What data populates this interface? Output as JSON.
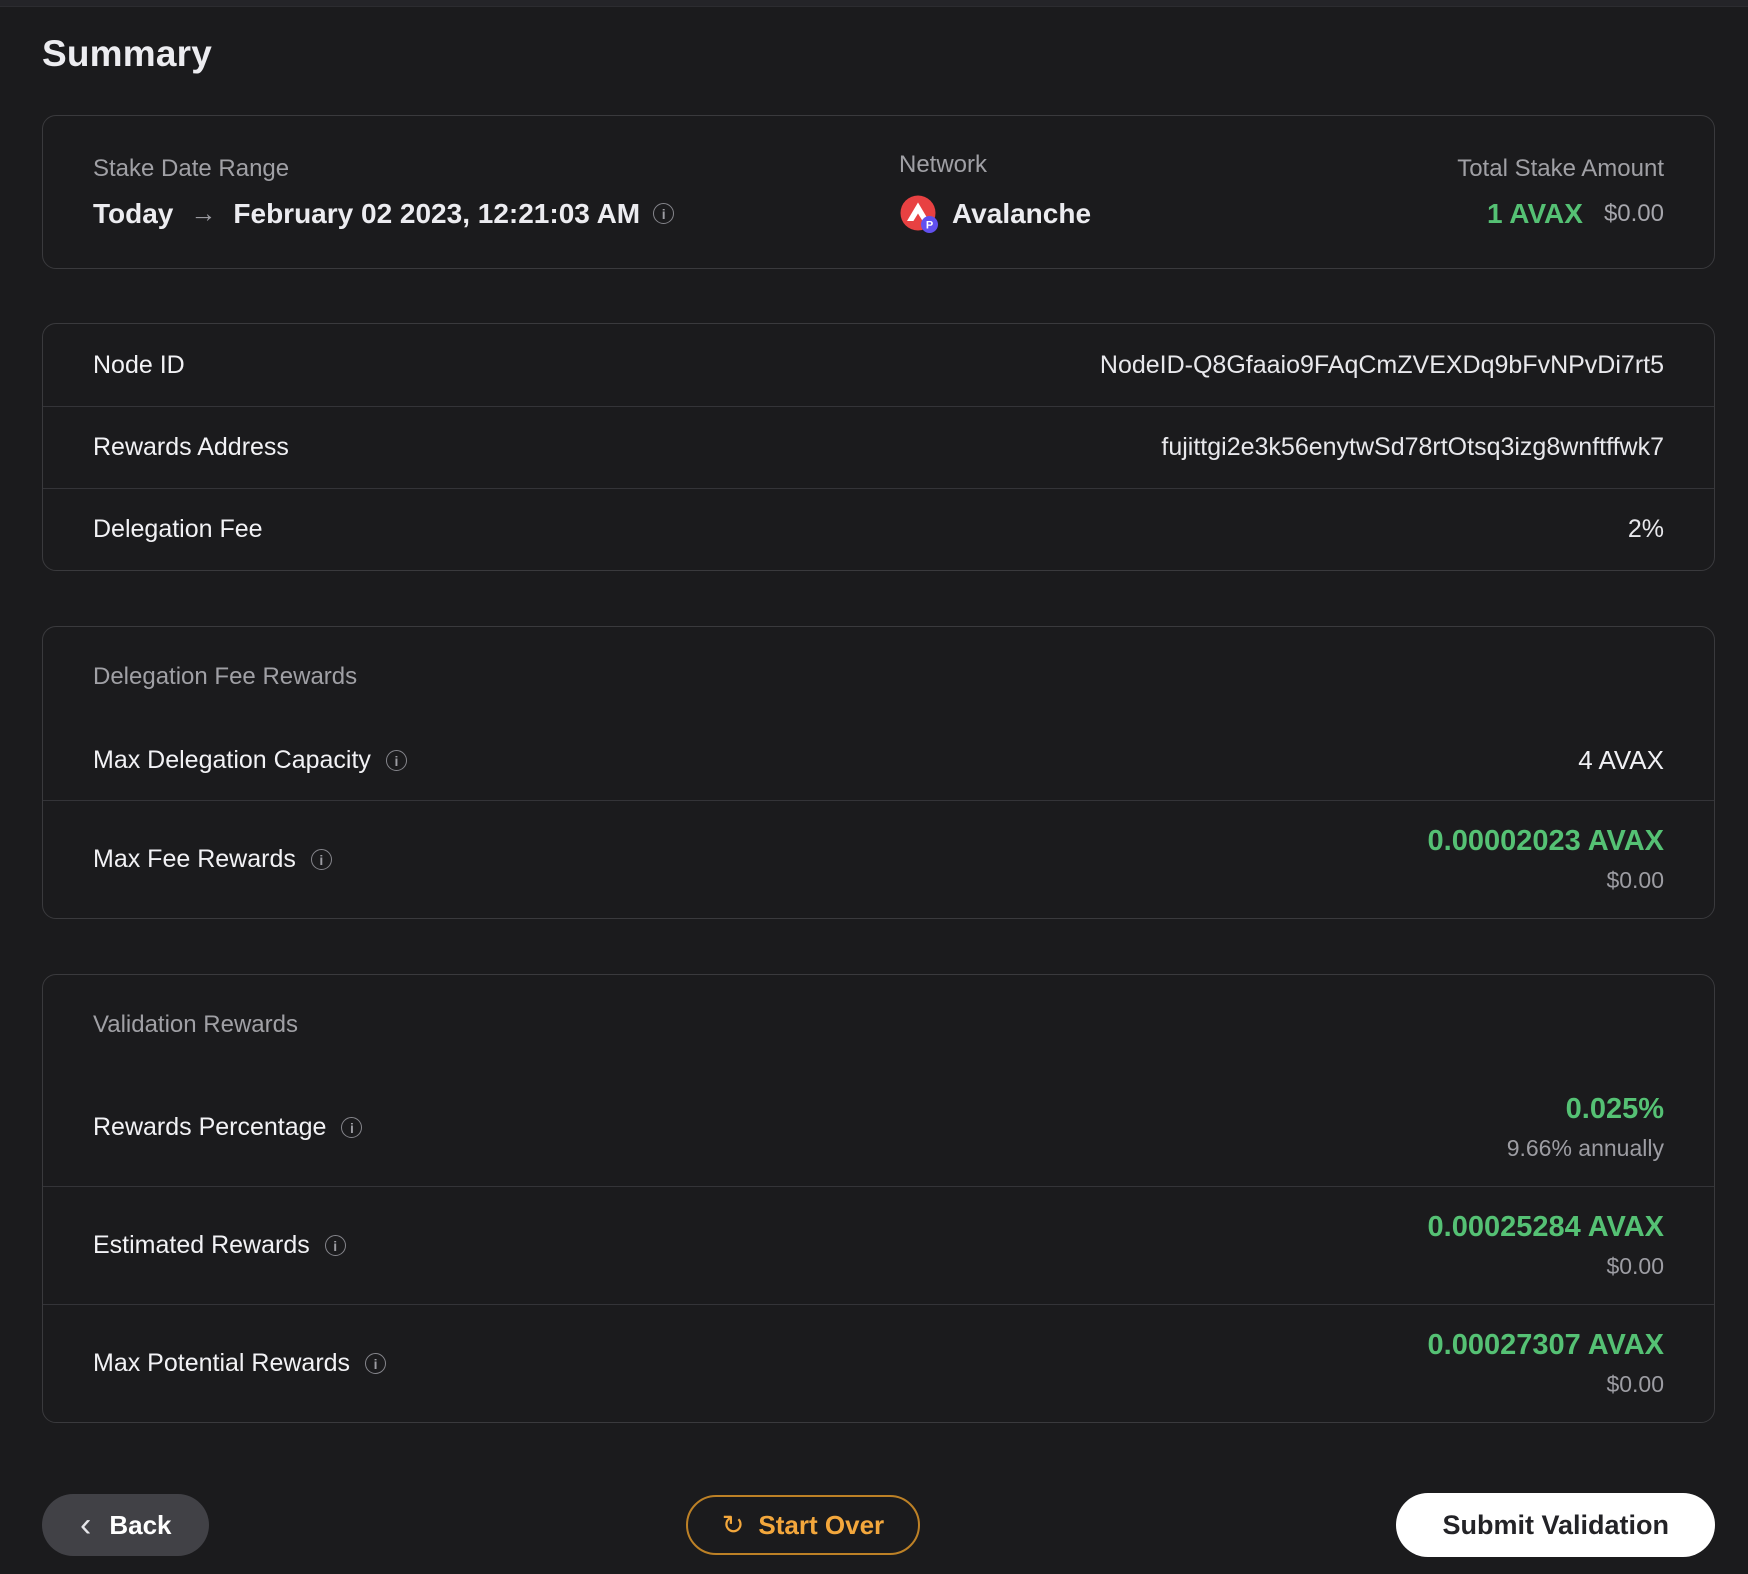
{
  "page": {
    "title": "Summary"
  },
  "colors": {
    "green": "#55c174",
    "orange": "#f3a73c",
    "avalanche_red": "#e84142",
    "p_chain_badge": "#6150ee"
  },
  "icons": {
    "arrow_right": "→",
    "info": "i",
    "chevron_left": "‹",
    "refresh": "↻",
    "p_chain_badge": "P"
  },
  "overview": {
    "stake_date_range": {
      "label": "Stake Date Range",
      "from": "Today",
      "to": "February 02 2023, 12:21:03 AM"
    },
    "network": {
      "label": "Network",
      "value": "Avalanche"
    },
    "total_stake": {
      "label": "Total Stake Amount",
      "amount": "1 AVAX",
      "usd": "$0.00"
    }
  },
  "details": {
    "rows": [
      {
        "label": "Node ID",
        "value": "NodeID-Q8Gfaaio9FAqCmZVEXDq9bFvNPvDi7rt5"
      },
      {
        "label": "Rewards Address",
        "value": "fujittgi2e3k56enytwSd78rtOtsq3izg8wnftffwk7"
      },
      {
        "label": "Delegation Fee",
        "value": "2%"
      }
    ]
  },
  "delegation_fee_rewards": {
    "title": "Delegation Fee Rewards",
    "max_delegation_capacity": {
      "label": "Max Delegation Capacity",
      "value": "4 AVAX"
    },
    "max_fee_rewards": {
      "label": "Max Fee Rewards",
      "value": "0.00002023 AVAX",
      "usd": "$0.00"
    }
  },
  "validation_rewards": {
    "title": "Validation Rewards",
    "rewards_percentage": {
      "label": "Rewards Percentage",
      "value": "0.025%",
      "sub": "9.66% annually"
    },
    "estimated_rewards": {
      "label": "Estimated Rewards",
      "value": "0.00025284 AVAX",
      "usd": "$0.00"
    },
    "max_potential_rewards": {
      "label": "Max Potential Rewards",
      "value": "0.00027307 AVAX",
      "usd": "$0.00"
    }
  },
  "footer": {
    "back_label": "Back",
    "start_over_label": "Start Over",
    "submit_label": "Submit Validation"
  }
}
